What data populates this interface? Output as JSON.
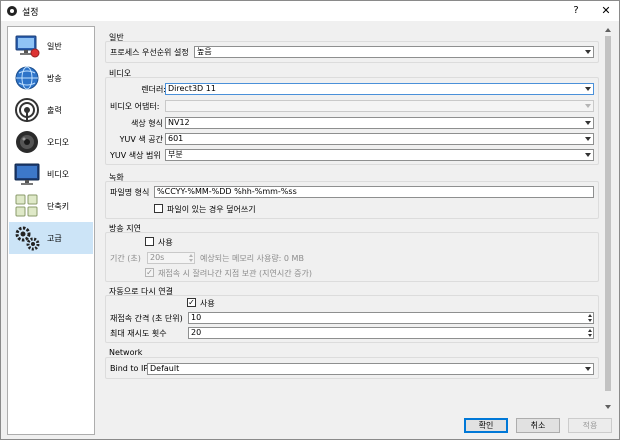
{
  "window": {
    "title": "설정",
    "help_glyph": "?",
    "close_glyph": "✕"
  },
  "sidebar": {
    "items": [
      {
        "label": "일반",
        "icon": "monitor-network-icon"
      },
      {
        "label": "방송",
        "icon": "broadcast-globe-icon"
      },
      {
        "label": "출력",
        "icon": "output-signal-icon"
      },
      {
        "label": "오디오",
        "icon": "speaker-icon"
      },
      {
        "label": "비디오",
        "icon": "display-icon"
      },
      {
        "label": "단축키",
        "icon": "keyboard-icon"
      },
      {
        "label": "고급",
        "icon": "gears-icon"
      }
    ],
    "selected": "고급"
  },
  "general": {
    "title": "일반",
    "process_priority_label": "프로세스 우선순위 설정",
    "process_priority_value": "높음"
  },
  "video": {
    "title": "비디오",
    "renderer_label": "렌더러:",
    "renderer_value": "Direct3D 11",
    "adapter_label": "비디오 어댑터:",
    "adapter_value": "",
    "color_format_label": "색상 형식",
    "color_format_value": "NV12",
    "yuv_space_label": "YUV 색 공간",
    "yuv_space_value": "601",
    "yuv_range_label": "YUV 색상 범위",
    "yuv_range_value": "부분"
  },
  "recording": {
    "title": "녹화",
    "filename_format_label": "파일명 형식",
    "filename_format_value": "%CCYY-%MM-%DD %hh-%mm-%ss",
    "overwrite_label": "파일이 있는 경우 덮어쓰기",
    "overwrite_checked": false
  },
  "stream_delay": {
    "title": "방송 지연",
    "enable_label": "사용",
    "enable_checked": false,
    "duration_label": "기간 (초)",
    "duration_value": "20s",
    "memory_estimate": "예상되는 메모리 사용량: 0 MB",
    "preserve_label": "재접속 시 잘려나간 지점 보관 (지연시간 증가)",
    "preserve_checked": true
  },
  "reconnect": {
    "title": "자동으로 다시 연결",
    "enable_label": "사용",
    "enable_checked": true,
    "enable_mark": "✓",
    "retry_delay_label": "재접속 간격 (초 단위)",
    "retry_delay_value": "10",
    "max_retries_label": "최대 재시도 횟수",
    "max_retries_value": "20"
  },
  "network": {
    "title": "Network",
    "bind_ip_label": "Bind to IP",
    "bind_ip_value": "Default"
  },
  "buttons": {
    "ok": "확인",
    "cancel": "취소",
    "apply": "적용"
  },
  "colors": {
    "selection": "#cce4f7",
    "focus": "#0078d7",
    "background": "#f0f0f0"
  }
}
